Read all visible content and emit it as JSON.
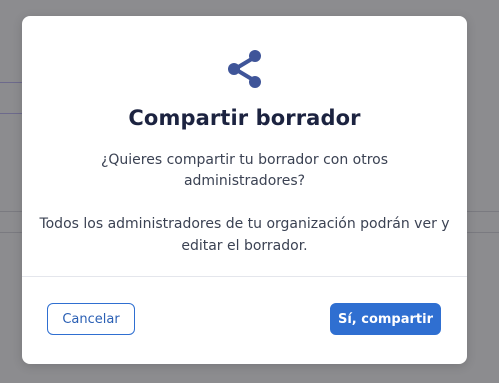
{
  "dialog": {
    "title": "Compartir borrador",
    "question": "¿Quieres compartir tu borrador con otros administradores?",
    "info": "Todos los administradores de tu organización podrán ver y editar el borrador.",
    "icon": "share-icon",
    "cancel_label": "Cancelar",
    "confirm_label": "Sí, compartir"
  },
  "colors": {
    "accent": "#2f6fd1",
    "icon": "#3f5599",
    "title": "#1c2340",
    "body_text": "#3b4253",
    "overlay": "#8c8c8f"
  }
}
